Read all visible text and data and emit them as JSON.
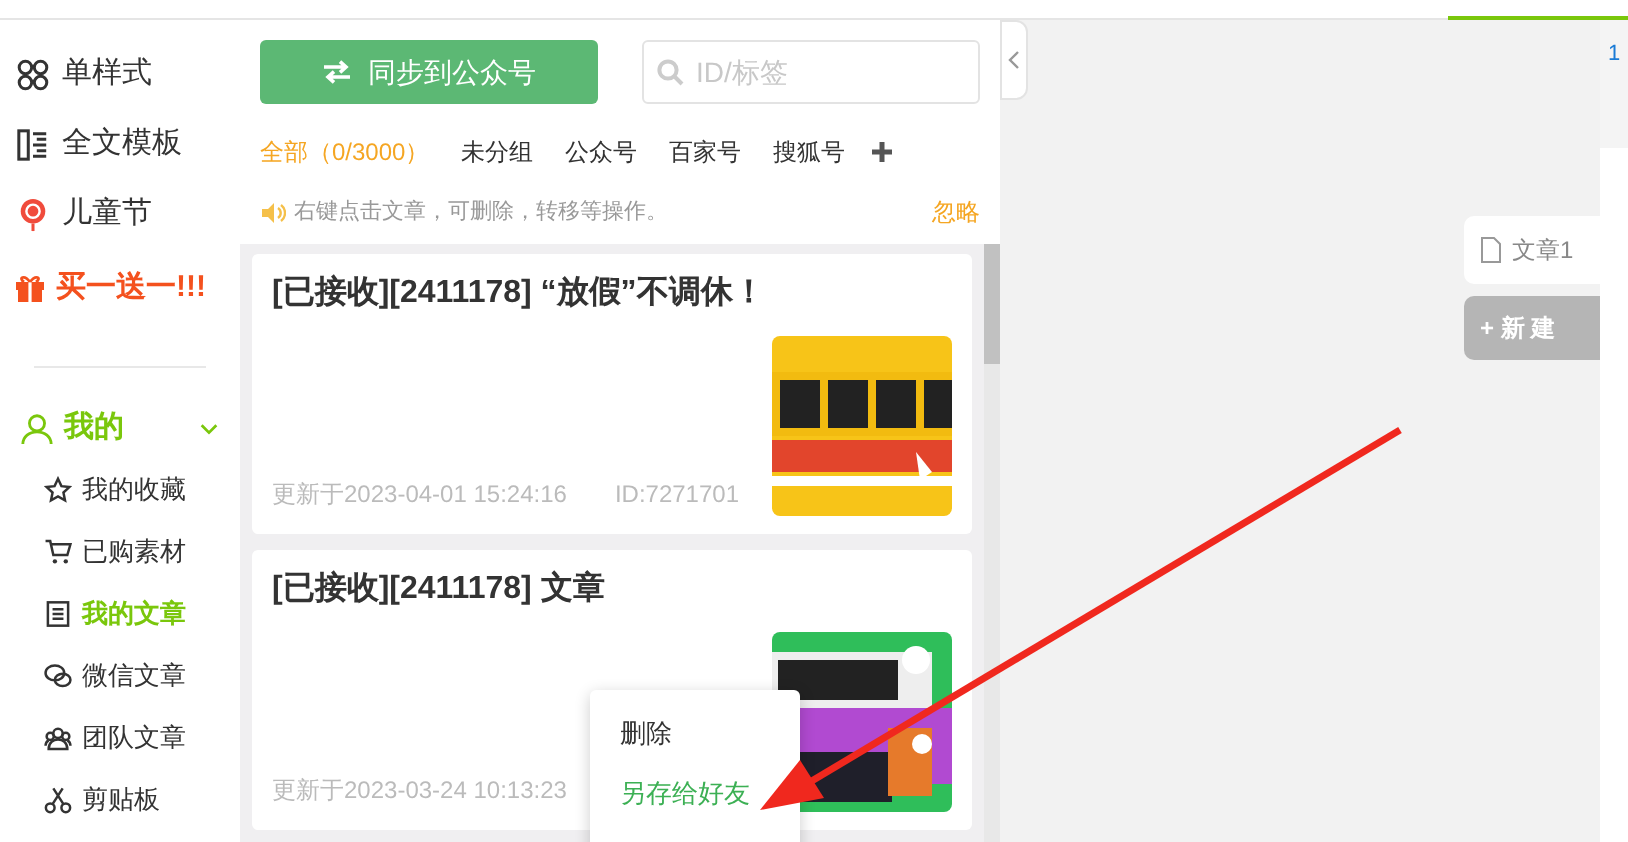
{
  "sidebar": {
    "top_items": [
      {
        "kind": "grid",
        "label": "单样式"
      },
      {
        "kind": "template",
        "label": "全文模板"
      },
      {
        "kind": "lollipop",
        "label": "儿童节"
      }
    ],
    "promo": "买一送一!!!",
    "section": {
      "label": "我的",
      "expanded": true,
      "items": [
        {
          "kind": "star",
          "label": "我的收藏",
          "selected": false
        },
        {
          "kind": "cart",
          "label": "已购素材",
          "selected": false
        },
        {
          "kind": "doc",
          "label": "我的文章",
          "selected": true
        },
        {
          "kind": "chat",
          "label": "微信文章",
          "selected": false
        },
        {
          "kind": "team",
          "label": "团队文章",
          "selected": false
        },
        {
          "kind": "scissors",
          "label": "剪贴板",
          "selected": false
        }
      ]
    }
  },
  "toolbar": {
    "sync_button": "同步到公众号",
    "search": {
      "placeholder": "ID/标签"
    }
  },
  "filters": [
    {
      "label": "全部（0/3000）",
      "selected": true
    },
    {
      "label": "未分组",
      "selected": false
    },
    {
      "label": "公众号",
      "selected": false
    },
    {
      "label": "百家号",
      "selected": false
    },
    {
      "label": "搜狐号",
      "selected": false
    }
  ],
  "tip": {
    "text": "右键点击文章，可删除，转移等操作。",
    "dismiss": "忽略"
  },
  "articles": [
    {
      "title": "[已接收][2411178] “放假”不调休！",
      "updated": "更新于2023-04-01 15:24:16",
      "id": "ID:7271701",
      "kind": "picture"
    },
    {
      "title": "[已接收][2411178] 文章",
      "updated": "更新于2023-03-24 10:13:23",
      "kind": "picture"
    }
  ],
  "context_menu": [
    {
      "label": "删除",
      "selected": false
    },
    {
      "label": "另存给好友",
      "selected": true
    }
  ],
  "doc_tabs": {
    "tab": "文章1",
    "new_button": "+ 新 建"
  },
  "right_strip": {
    "label": "1"
  }
}
